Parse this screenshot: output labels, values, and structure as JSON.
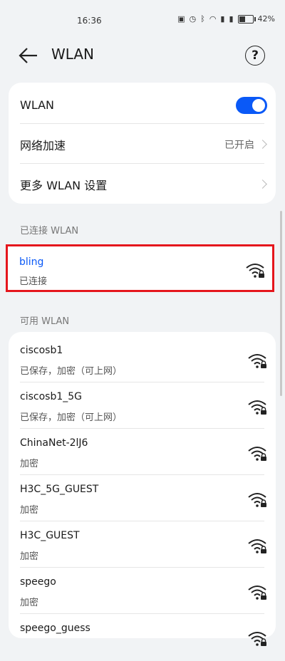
{
  "status_bar": {
    "time": "16:36",
    "icons": [
      "nfc-icon",
      "alarm-icon",
      "bluetooth-icon",
      "wifi-icon",
      "signal-4g-icon",
      "signal-4g-icon",
      "battery-icon"
    ],
    "battery": "42%",
    "battery_level": 0.42
  },
  "header": {
    "title": "WLAN",
    "back_icon": "back-arrow-icon",
    "help_icon": "help-icon"
  },
  "settings": {
    "wlan_label": "WLAN",
    "wlan_enabled": true,
    "network_boost_label": "网络加速",
    "network_boost_value": "已开启",
    "more_settings_label": "更多 WLAN 设置"
  },
  "connected_section": {
    "title": "已连接 WLAN",
    "network": {
      "name": "bling",
      "status": "已连接"
    }
  },
  "available_section": {
    "title": "可用 WLAN",
    "networks": [
      {
        "name": "ciscosb1",
        "status": "已保存，加密（可上网）"
      },
      {
        "name": "ciscosb1_5G",
        "status": "已保存，加密（可上网）"
      },
      {
        "name": "ChinaNet-2lJ6",
        "status": "加密"
      },
      {
        "name": "H3C_5G_GUEST",
        "status": "加密"
      },
      {
        "name": "H3C_GUEST",
        "status": "加密"
      },
      {
        "name": "speego",
        "status": "加密"
      },
      {
        "name": "speego_guess",
        "status": ""
      }
    ]
  },
  "colors": {
    "accent": "#0a59f7",
    "highlight_border": "#e5161d",
    "connected_name": "#0a59f7"
  }
}
